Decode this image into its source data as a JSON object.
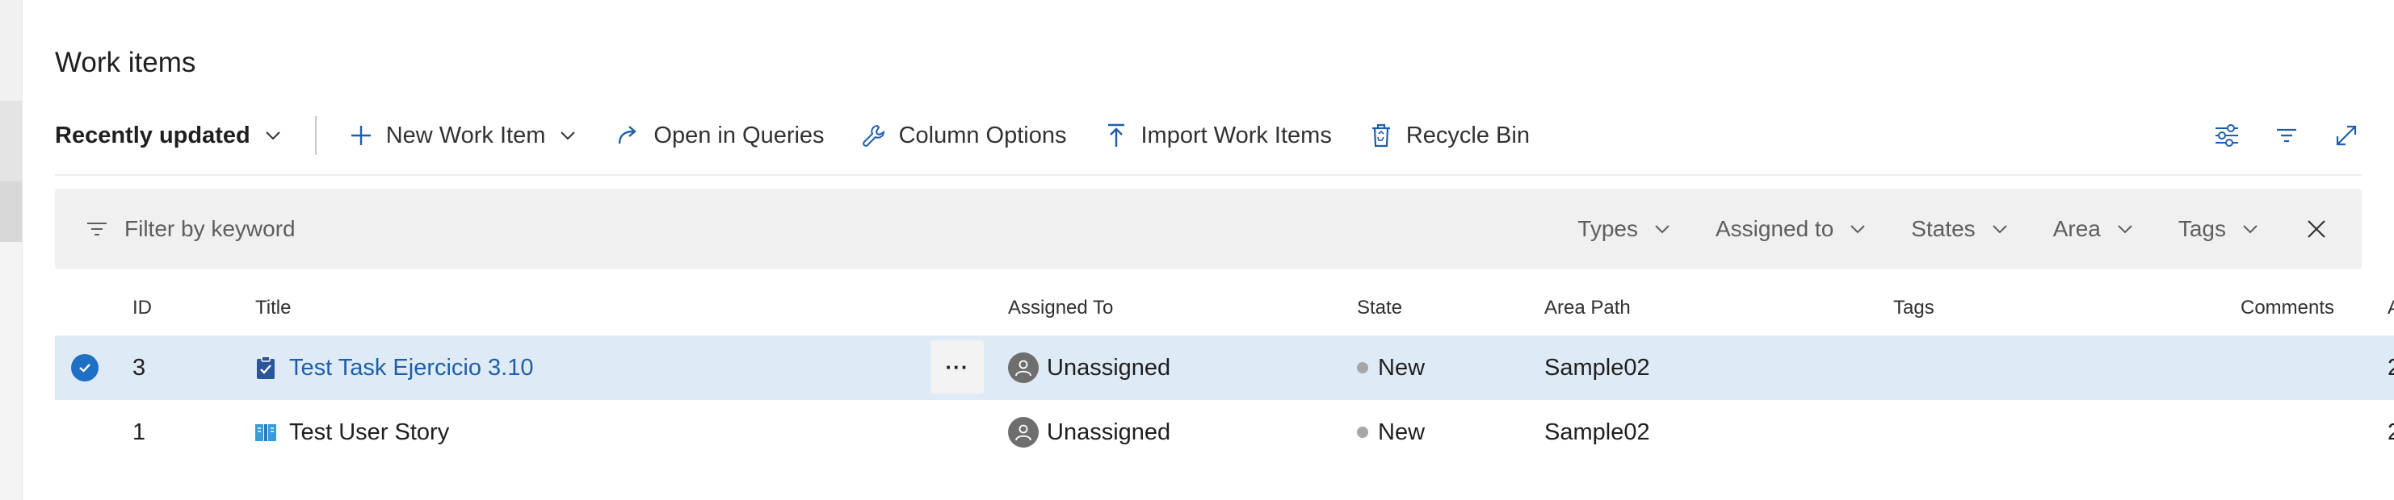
{
  "page": {
    "title": "Work items"
  },
  "toolbar": {
    "view_select": "Recently updated",
    "new_work_item": "New Work Item",
    "open_in_queries": "Open in Queries",
    "column_options": "Column Options",
    "import_work_items": "Import Work Items",
    "recycle_bin": "Recycle Bin"
  },
  "filter": {
    "placeholder": "Filter by keyword",
    "pickers": {
      "types": "Types",
      "assigned_to": "Assigned to",
      "states": "States",
      "area": "Area",
      "tags": "Tags"
    }
  },
  "grid": {
    "columns": {
      "id": "ID",
      "title": "Title",
      "assigned_to": "Assigned To",
      "state": "State",
      "area_path": "Area Path",
      "tags": "Tags",
      "comments": "Comments",
      "cut_off": "A"
    },
    "rows": [
      {
        "id": "3",
        "type": "Task",
        "title": "Test Task Ejercicio 3.10",
        "assigned_to": "Unassigned",
        "state": "New",
        "area_path": "Sample02",
        "tags": "",
        "trailing": "2",
        "selected": true
      },
      {
        "id": "1",
        "type": "User Story",
        "title": "Test User Story",
        "assigned_to": "Unassigned",
        "state": "New",
        "area_path": "Sample02",
        "tags": "",
        "trailing": "2",
        "selected": false
      }
    ],
    "more_actions": "···"
  },
  "colors": {
    "accent": "#1f6fc5",
    "link": "#1f5fa8",
    "selected_row": "#deebf7",
    "filter_bg": "#f0f0f0",
    "state_new_dot": "#a6a6a6",
    "task_icon": "#2b579a",
    "story_icon": "#3a9bd9"
  },
  "icons": {
    "new": "plus-icon",
    "queries": "redo-arrow-icon",
    "column_options": "wrench-icon",
    "import": "upload-arrow-icon",
    "recycle": "recycle-bin-icon",
    "view_options": "sliders-icon",
    "filter": "filter-icon",
    "fullscreen": "expand-icon",
    "close": "close-icon",
    "selected": "checkmark-icon",
    "task": "task-clipboard-icon",
    "user_story": "book-icon",
    "unassigned": "unassigned-avatar-icon"
  }
}
